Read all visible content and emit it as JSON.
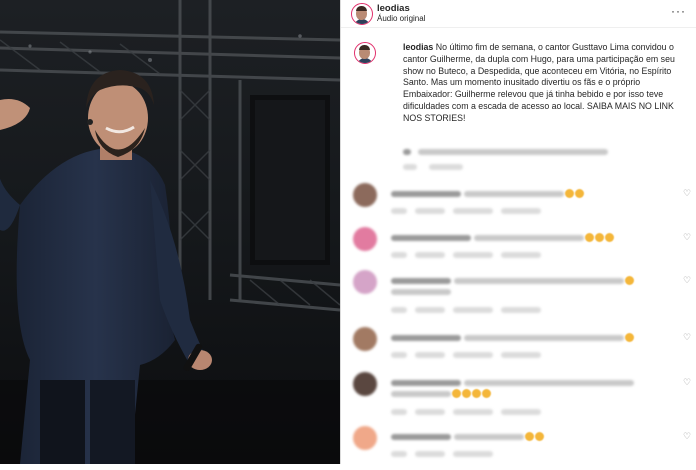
{
  "post": {
    "username": "leodias",
    "audio_label": "Áudio original",
    "caption_user": "leodias",
    "caption_text": "No último fim de semana, o cantor Gusttavo Lima convidou o cantor Guilherme, da dupla com Hugo, para uma participação em seu show no Buteco, a Despedida, que aconteceu em Vitória, no Espírito Santo. Mas um momento inusitado divertiu os fãs e o próprio Embaixador: Guilherme relevou que já tinha bebido e por isso teve dificuldades com a escada de acesso ao local. SAIBA MAIS NO LINK NOS STORIES!"
  },
  "icons": {
    "more": "more-options-icon",
    "like": "heart-icon"
  },
  "colors": {
    "story_ring": "#e1306c",
    "text": "#262626",
    "muted": "#8e8e8e",
    "emoji": "#f4b63a"
  },
  "comments": [
    {
      "avatar_color": "#8c6a5c"
    },
    {
      "avatar_color": "#e27ba0"
    },
    {
      "avatar_color": "#d5a4c8"
    },
    {
      "avatar_color": "#a27a63"
    },
    {
      "avatar_color": "#5a4740"
    },
    {
      "avatar_color": "#f0a889"
    }
  ]
}
